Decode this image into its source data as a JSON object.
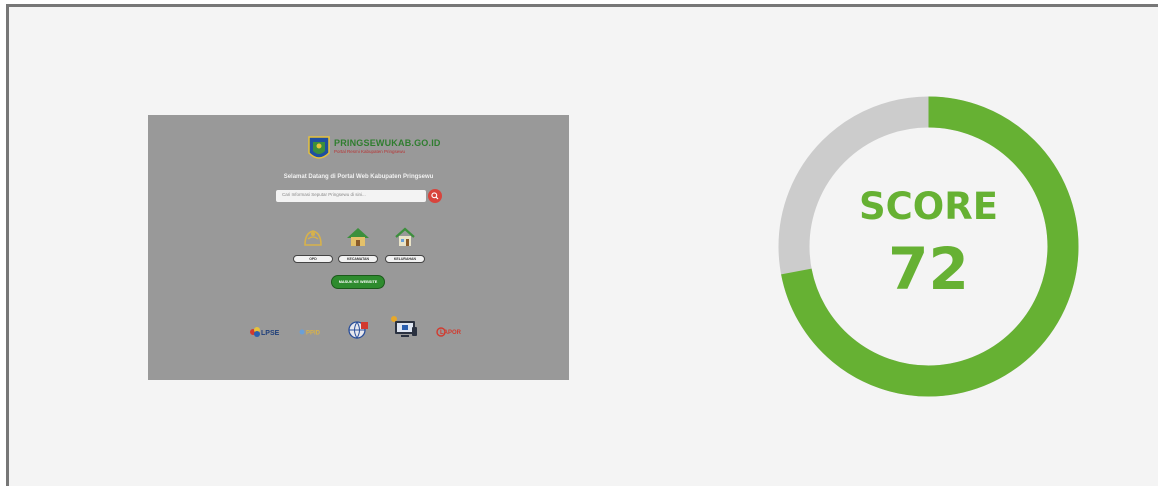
{
  "preview": {
    "logo_title": "PRINGSEWUKAB.GO.ID",
    "logo_subtitle": "Portal Resmi Kabupaten Pringsewu",
    "welcome": "Selamat Datang di Portal Web Kabupaten Pringsewu",
    "search_placeholder": "Cari Informasi Seputar Pringsewu di sini...",
    "categories": [
      {
        "label": "OPD"
      },
      {
        "label": "KECAMATAN"
      },
      {
        "label": "KELURAHAN"
      }
    ],
    "visit_button": "MASUK KE WEBSITE",
    "partners": [
      {
        "label": "LPSE"
      },
      {
        "label": "PPID"
      },
      {
        "label": ""
      },
      {
        "label": ""
      },
      {
        "label": "LAPOR"
      }
    ]
  },
  "score": {
    "label": "SCORE",
    "value": 72,
    "value_text": "72",
    "max": 100,
    "colors": {
      "fill": "#66b133",
      "track": "#cccccc"
    }
  }
}
